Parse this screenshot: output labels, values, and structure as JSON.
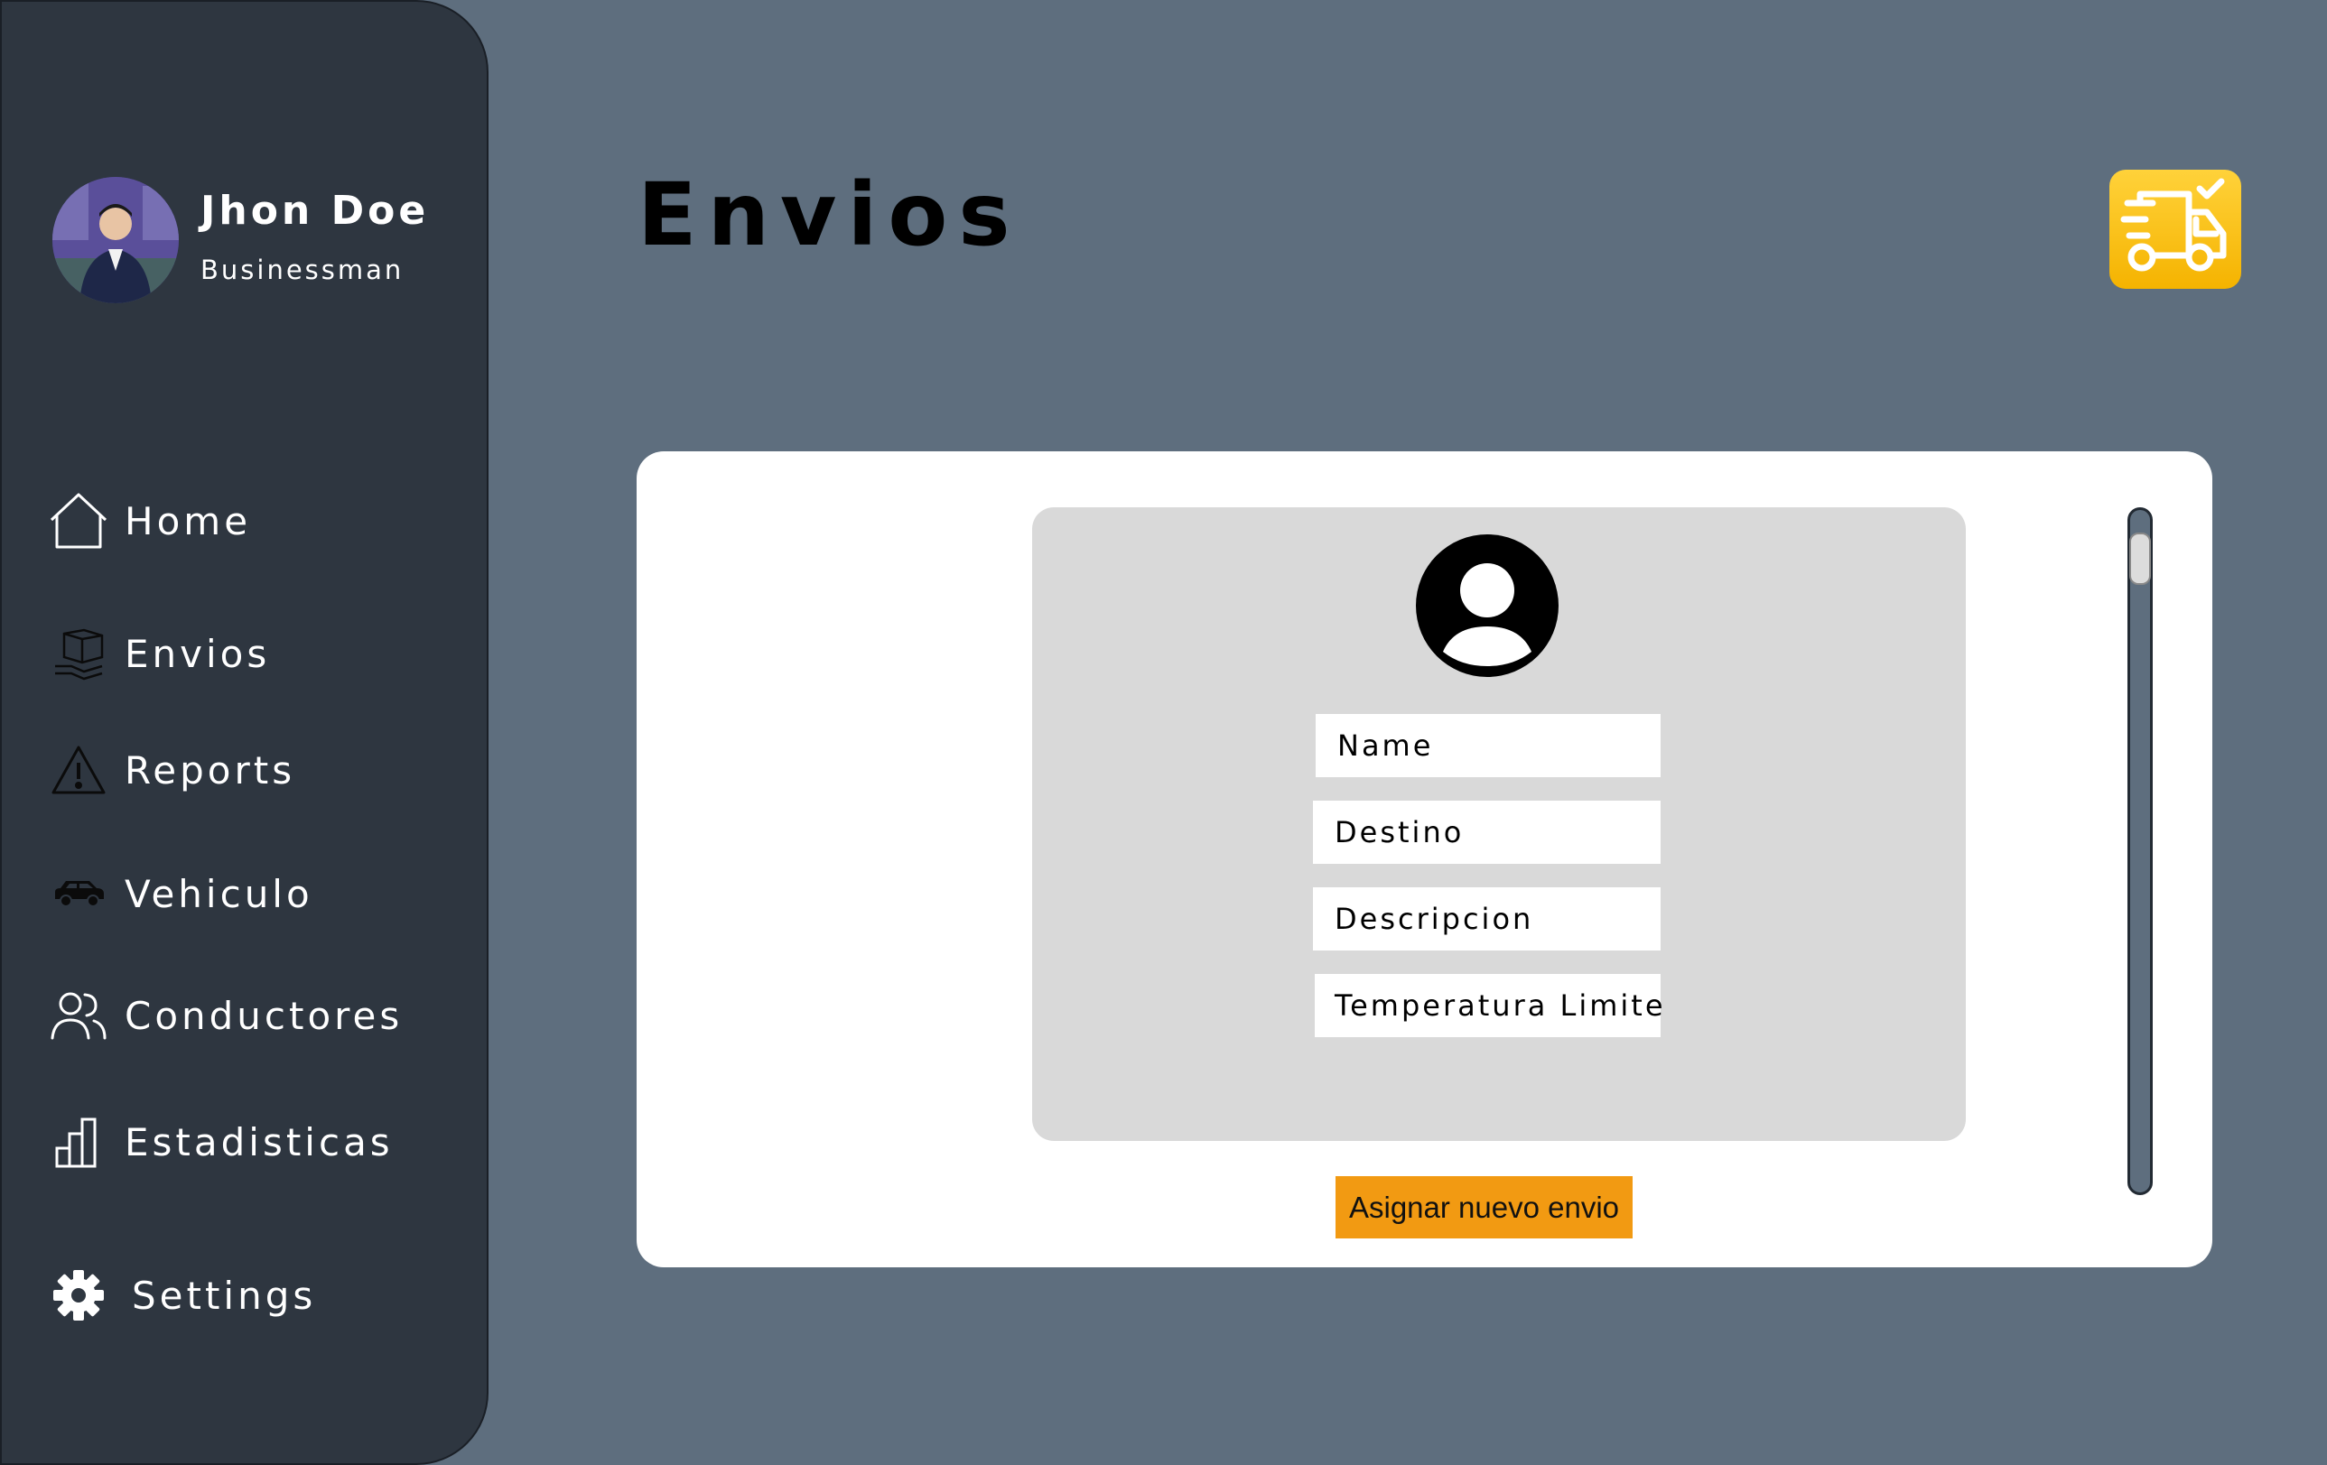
{
  "user": {
    "name": "Jhon Doe",
    "role": "Businessman"
  },
  "nav": {
    "items": [
      {
        "label": "Home",
        "icon": "home-icon"
      },
      {
        "label": "Envios",
        "icon": "package-icon"
      },
      {
        "label": "Reports",
        "icon": "warning-icon"
      },
      {
        "label": "Vehiculo",
        "icon": "car-icon"
      },
      {
        "label": "Conductores",
        "icon": "users-icon"
      },
      {
        "label": "Estadisticas",
        "icon": "bar-chart-icon"
      },
      {
        "label": "Settings",
        "icon": "gear-icon"
      }
    ]
  },
  "page": {
    "title": "Envios",
    "badge_icon": "delivery-truck-icon"
  },
  "form": {
    "avatar_icon": "user-circle-icon",
    "fields": {
      "name": "Name",
      "destino": "Destino",
      "descripcion": "Descripcion",
      "temperatura": "Temperatura Limite"
    },
    "submit_label": "Asignar nuevo envio"
  },
  "colors": {
    "background": "#5e6e7e",
    "sidebar": "#2e3640",
    "panel": "#ffffff",
    "card": "#d9d9d9",
    "accent_button": "#f29a12",
    "truck_badge": "#f5b300"
  }
}
